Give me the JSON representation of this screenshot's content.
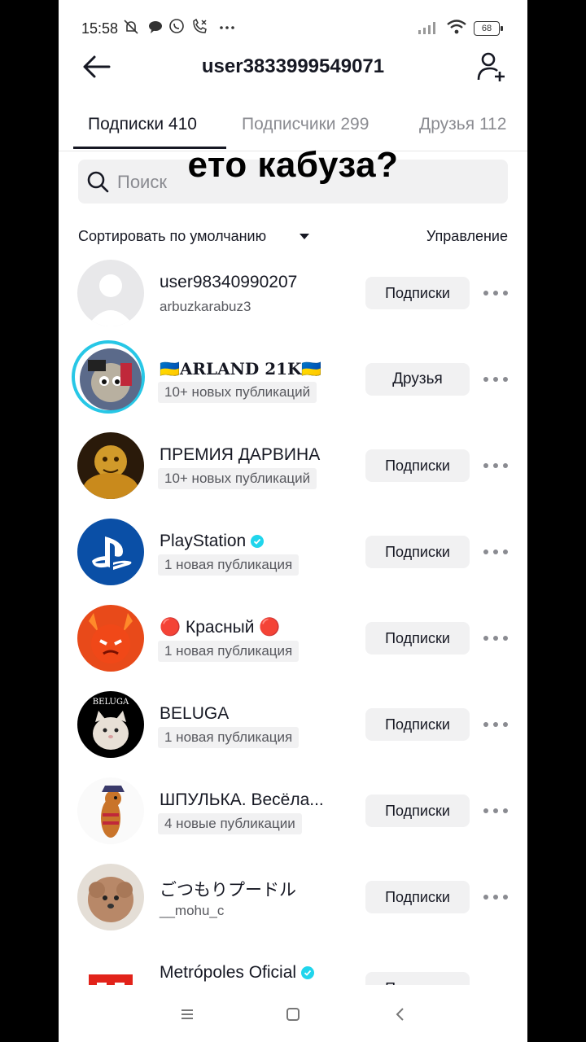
{
  "status": {
    "time": "15:58",
    "battery": "68"
  },
  "header": {
    "title": "user3833999549071"
  },
  "tabs": [
    {
      "label": "Подписки 410"
    },
    {
      "label": "Подписчики 299"
    },
    {
      "label": "Друзья 112"
    }
  ],
  "search": {
    "placeholder": "Поиск"
  },
  "overlay_caption": "ето кабуза?",
  "sort": {
    "label": "Сортировать по умолчанию",
    "manage": "Управление"
  },
  "rows": [
    {
      "name": "user98340990207",
      "sub": "arbuzkarabuz3",
      "button": "Подписки"
    },
    {
      "name": "🇺🇦ARLAND 21K🇺🇦",
      "sub": "10+ новых публикаций",
      "button": "Друзья"
    },
    {
      "name": "ПРЕМИЯ ДАРВИНА",
      "sub": "10+ новых публикаций",
      "button": "Подписки"
    },
    {
      "name": "PlayStation",
      "sub": "1 новая публикация",
      "button": "Подписки"
    },
    {
      "name": "🔴 Красный 🔴",
      "sub": "1 новая публикация",
      "button": "Подписки"
    },
    {
      "name": "BELUGA",
      "sub": "1 новая публикация",
      "button": "Подписки",
      "avatar_text": "BELUGA"
    },
    {
      "name": "ШПУЛЬКА. Весёла...",
      "sub": "4 новые публикации",
      "button": "Подписки"
    },
    {
      "name": "ごつもりプードル",
      "sub": "__mohu_c",
      "button": "Подписки"
    },
    {
      "name": "Metrópoles Oficial",
      "sub": "",
      "button": "Подписки"
    }
  ],
  "colors": {
    "accent_ring": "#27c7e6",
    "verified": "#20d5ec",
    "text": "#161823",
    "muted": "#8a8b91"
  }
}
